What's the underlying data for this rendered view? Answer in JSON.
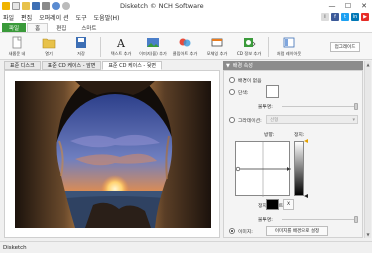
{
  "window": {
    "title": "Disketch © NCH Software",
    "controls": [
      "—",
      "☐",
      "✕"
    ]
  },
  "menu": [
    "파일",
    "편집",
    "오퍼레이 션",
    "도구",
    "도움말(H)"
  ],
  "social": {
    "icons": [
      "facebook-icon",
      "twitter-icon",
      "linkedin-icon",
      "youtube-icon"
    ],
    "colors": [
      "#3b5998",
      "#1da1f2",
      "#0077b5",
      "#e52d27"
    ]
  },
  "ribbon_tabs": [
    "파일",
    "홈",
    "편집",
    "스마트"
  ],
  "toolbar": {
    "buttons": [
      {
        "label": "새롭운 네",
        "icon": "new-icon"
      },
      {
        "label": "열기",
        "icon": "open-folder-icon"
      },
      {
        "label": "저장",
        "icon": "save-disk-icon"
      },
      {
        "label": "텍스트 추가",
        "icon": "text-icon"
      },
      {
        "label": "이미지(을) 추가",
        "icon": "image-icon"
      },
      {
        "label": "클립아트 추가",
        "icon": "clipart-icon"
      },
      {
        "label": "모체잉 추가",
        "icon": "shape-icon"
      },
      {
        "label": "CD 정보 추가",
        "icon": "cd-info-icon"
      },
      {
        "label": "처럼 레이아웃",
        "icon": "layout-icon"
      }
    ],
    "help_label": "업그레이드"
  },
  "doc_tabs": [
    "표준 디스크",
    "표준 CD 케이스 - 앞면",
    "표준 CD 케이스 - 뒷면"
  ],
  "panel": {
    "header": "배경 속성",
    "options": {
      "none": "배경이 없음",
      "solid": "단색:",
      "transparency": "불투명:",
      "gradient": "그라데이션:",
      "gradient_select": "선형",
      "direction": "방향:",
      "midpoint": "정지:",
      "stop_color": "정지 유 인트:",
      "stop_btn": "X",
      "opacity2": "불투명:",
      "image": "이미지:",
      "image_btn": "이미지를 배경으로 설정"
    },
    "colors": {
      "solid_swatch": "#ffffff",
      "stop_swatch": "#000000"
    }
  },
  "status": {
    "text": "Disketch"
  }
}
